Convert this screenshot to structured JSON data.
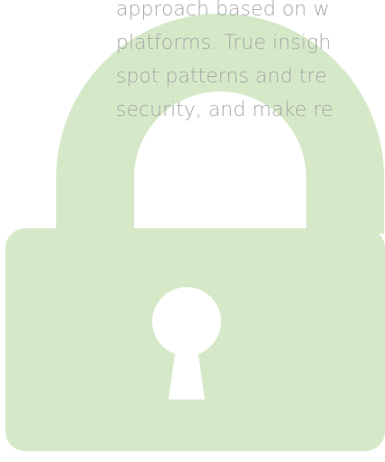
{
  "body_text": {
    "lines": [
      "approach based on w",
      "platforms. True insigh",
      "spot patterns and tre",
      "security, and make re"
    ]
  },
  "illustration": {
    "icon": "padlock-icon",
    "color": "#d5e9c8",
    "keyhole_color": "#ffffff"
  }
}
